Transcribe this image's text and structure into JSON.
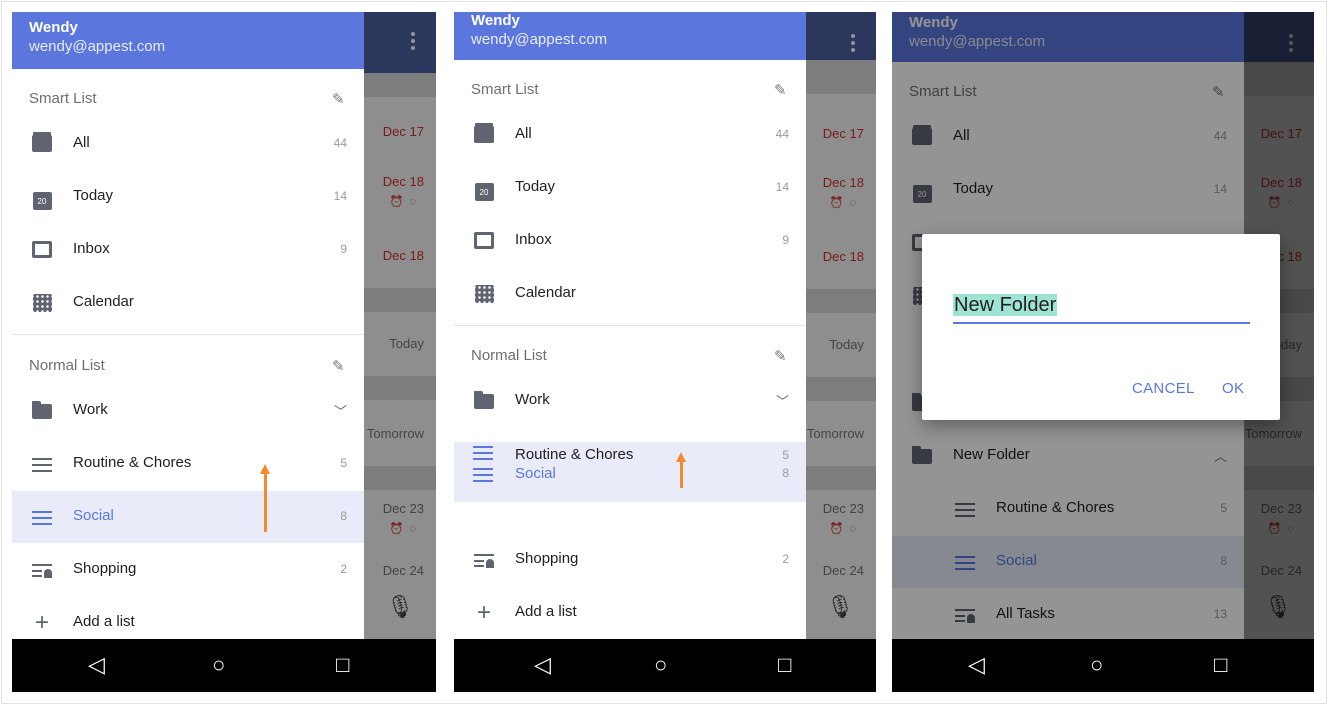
{
  "user": {
    "name": "Wendy",
    "email": "wendy@appest.com"
  },
  "smart_list": {
    "title": "Smart List",
    "items": [
      {
        "label": "All",
        "count": "44",
        "icon": "all-tasks-icon"
      },
      {
        "label": "Today",
        "count": "14",
        "icon": "calendar-day-icon",
        "day": "20"
      },
      {
        "label": "Inbox",
        "count": "9",
        "icon": "inbox-icon"
      },
      {
        "label": "Calendar",
        "count": "",
        "icon": "calendar-grid-icon"
      }
    ]
  },
  "normal_list": {
    "title": "Normal List",
    "work": "Work",
    "routine": {
      "label": "Routine & Chores",
      "count": "5"
    },
    "social": {
      "label": "Social",
      "count": "8"
    },
    "shopping": {
      "label": "Shopping",
      "count": "2"
    },
    "add": "Add a list"
  },
  "background": {
    "dates": [
      "Dec 17",
      "Dec 18",
      "Dec 18",
      "Today",
      "Tomorrow",
      "Dec 23",
      "Dec 24"
    ]
  },
  "folder": {
    "name": "New Folder",
    "routine": {
      "label": "Routine & Chores",
      "count": "5"
    },
    "social": {
      "label": "Social",
      "count": "8"
    },
    "all_tasks": {
      "label": "All Tasks",
      "count": "13"
    }
  },
  "dialog": {
    "input_value": "New Folder",
    "cancel": "CANCEL",
    "ok": "OK"
  },
  "colors": {
    "accent": "#5b76dd",
    "header": "#5b76dd",
    "due": "#d32f2f",
    "arrow": "#f6892c"
  }
}
